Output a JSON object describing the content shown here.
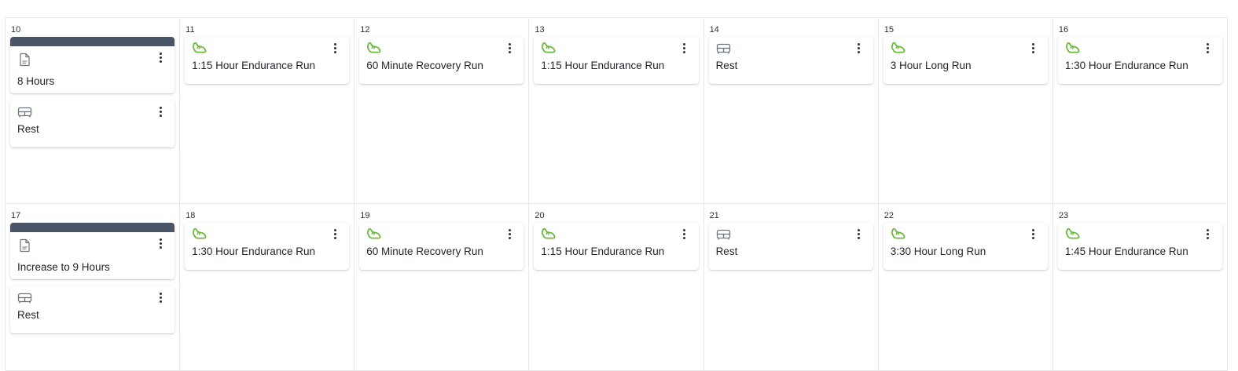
{
  "colors": {
    "note_bar": "#4a5467",
    "run_icon": "#6aba3a",
    "rest_icon": "#6b7280",
    "grid_line": "#e6e8eb"
  },
  "weeks": [
    {
      "days": [
        {
          "date": "10",
          "items": [
            {
              "type": "note",
              "icon": "document-icon",
              "title": "8 Hours"
            },
            {
              "type": "rest",
              "icon": "sofa-icon",
              "title": "Rest"
            }
          ]
        },
        {
          "date": "11",
          "items": [
            {
              "type": "run",
              "icon": "running-shoe-icon",
              "title": "1:15 Hour Endurance Run"
            }
          ]
        },
        {
          "date": "12",
          "items": [
            {
              "type": "run",
              "icon": "running-shoe-icon",
              "title": "60 Minute Recovery Run"
            }
          ]
        },
        {
          "date": "13",
          "items": [
            {
              "type": "run",
              "icon": "running-shoe-icon",
              "title": "1:15 Hour Endurance Run"
            }
          ]
        },
        {
          "date": "14",
          "items": [
            {
              "type": "rest",
              "icon": "sofa-icon",
              "title": "Rest"
            }
          ]
        },
        {
          "date": "15",
          "items": [
            {
              "type": "run",
              "icon": "running-shoe-icon",
              "title": "3 Hour Long Run"
            }
          ]
        },
        {
          "date": "16",
          "items": [
            {
              "type": "run",
              "icon": "running-shoe-icon",
              "title": "1:30 Hour Endurance Run"
            }
          ]
        }
      ]
    },
    {
      "days": [
        {
          "date": "17",
          "items": [
            {
              "type": "note",
              "icon": "document-icon",
              "title": "Increase to 9 Hours"
            },
            {
              "type": "rest",
              "icon": "sofa-icon",
              "title": "Rest"
            }
          ]
        },
        {
          "date": "18",
          "items": [
            {
              "type": "run",
              "icon": "running-shoe-icon",
              "title": "1:30 Hour Endurance Run"
            }
          ]
        },
        {
          "date": "19",
          "items": [
            {
              "type": "run",
              "icon": "running-shoe-icon",
              "title": "60 Minute Recovery Run"
            }
          ]
        },
        {
          "date": "20",
          "items": [
            {
              "type": "run",
              "icon": "running-shoe-icon",
              "title": "1:15 Hour Endurance Run"
            }
          ]
        },
        {
          "date": "21",
          "items": [
            {
              "type": "rest",
              "icon": "sofa-icon",
              "title": "Rest"
            }
          ]
        },
        {
          "date": "22",
          "items": [
            {
              "type": "run",
              "icon": "running-shoe-icon",
              "title": "3:30 Hour Long Run"
            }
          ]
        },
        {
          "date": "23",
          "items": [
            {
              "type": "run",
              "icon": "running-shoe-icon",
              "title": "1:45 Hour Endurance Run"
            }
          ]
        }
      ]
    }
  ]
}
